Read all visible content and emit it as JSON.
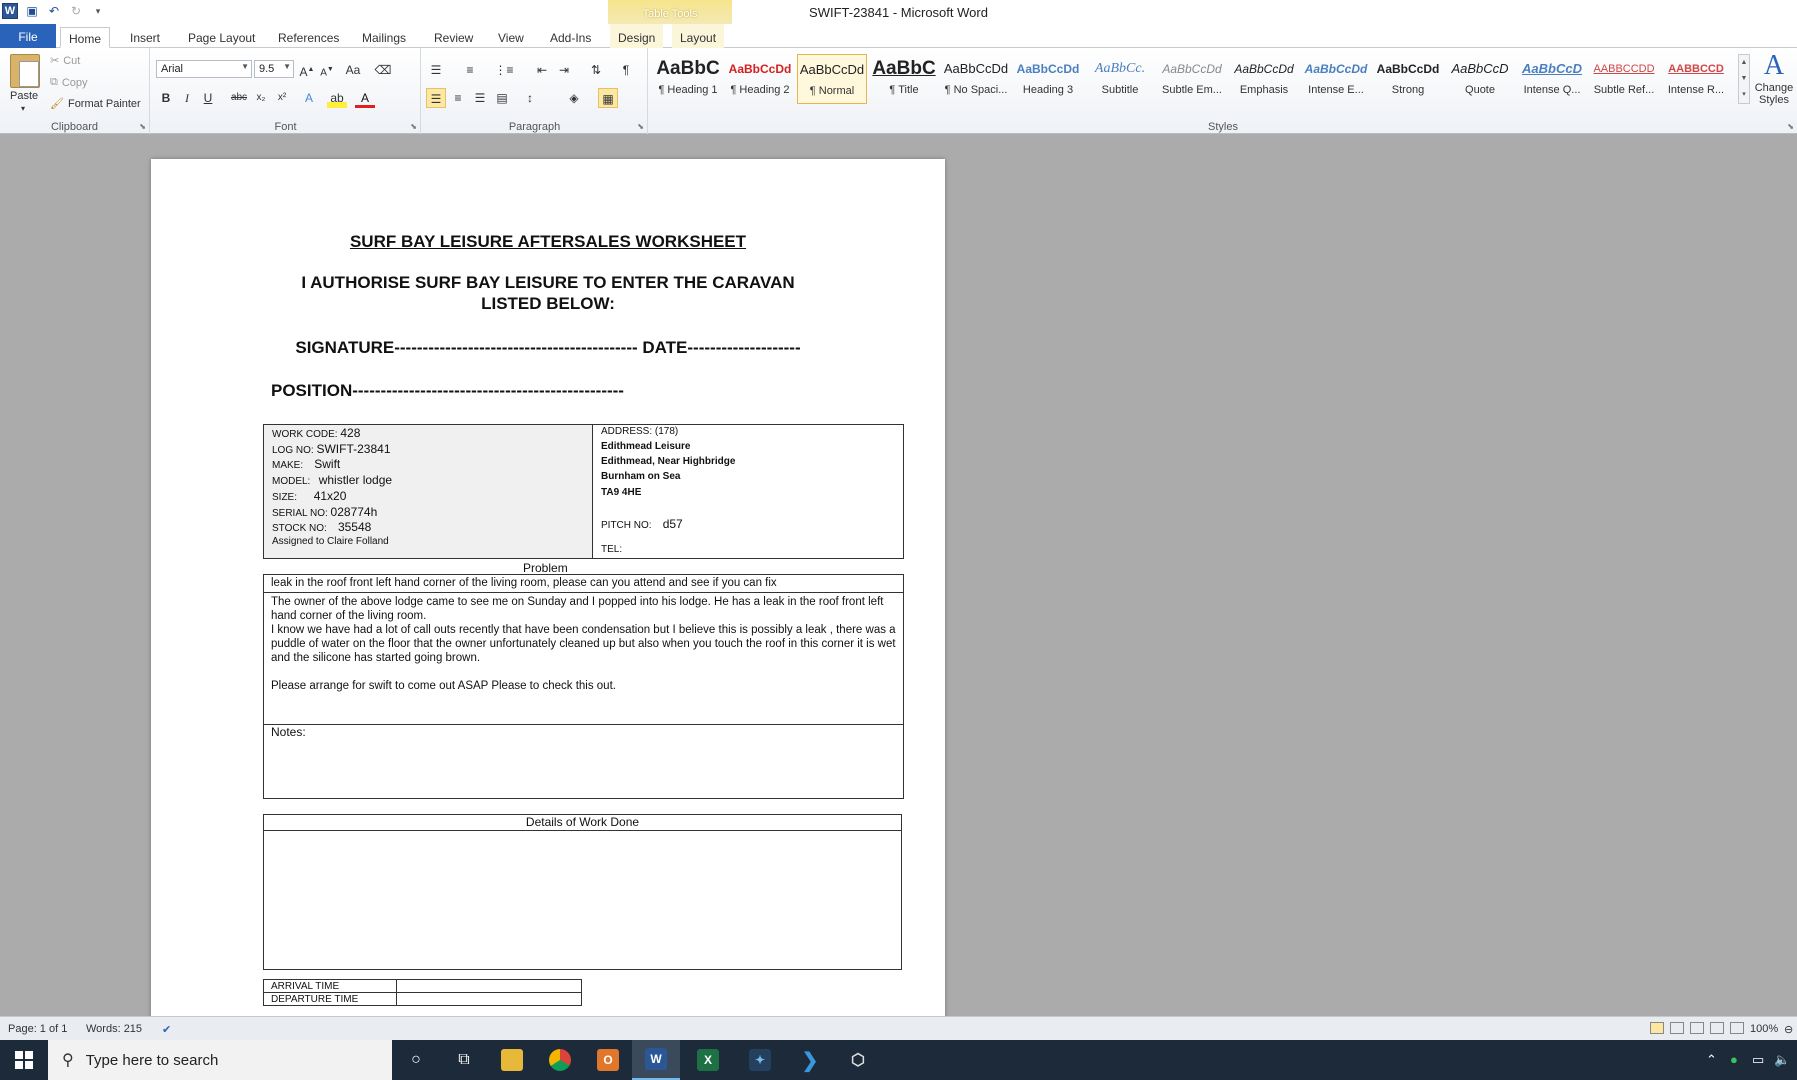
{
  "window": {
    "title": "SWIFT-23841  -  Microsoft Word",
    "table_tools_label": "Table Tools"
  },
  "tabs": [
    {
      "label": "File"
    },
    {
      "label": "Home"
    },
    {
      "label": "Insert"
    },
    {
      "label": "Page Layout"
    },
    {
      "label": "References"
    },
    {
      "label": "Mailings"
    },
    {
      "label": "Review"
    },
    {
      "label": "View"
    },
    {
      "label": "Add-Ins"
    },
    {
      "label": "Design"
    },
    {
      "label": "Layout"
    }
  ],
  "clipboard": {
    "paste": "Paste",
    "cut": "Cut",
    "copy": "Copy",
    "format_painter": "Format Painter",
    "group": "Clipboard"
  },
  "font": {
    "name": "Arial",
    "size": "9.5",
    "group": "Font"
  },
  "paragraph": {
    "group": "Paragraph"
  },
  "styles": {
    "group": "Styles",
    "items": [
      {
        "sample": "AaBbC",
        "name": "¶ Heading 1"
      },
      {
        "sample": "AaBbCcDd",
        "name": "¶ Heading 2"
      },
      {
        "sample": "AaBbCcDd",
        "name": "¶ Normal"
      },
      {
        "sample": "AaBbC",
        "name": "¶ Title"
      },
      {
        "sample": "AaBbCcDd",
        "name": "¶ No Spaci..."
      },
      {
        "sample": "AaBbCcDd",
        "name": "Heading 3"
      },
      {
        "sample": "AaBbCc.",
        "name": "Subtitle"
      },
      {
        "sample": "AaBbCcDd",
        "name": "Subtle Em..."
      },
      {
        "sample": "AaBbCcDd",
        "name": "Emphasis"
      },
      {
        "sample": "AaBbCcDd",
        "name": "Intense E..."
      },
      {
        "sample": "AaBbCcDd",
        "name": "Strong"
      },
      {
        "sample": "AaBbCcD",
        "name": "Quote"
      },
      {
        "sample": "AaBbCcD",
        "name": "Intense Q..."
      },
      {
        "sample": "AABBCCDD",
        "name": "Subtle Ref..."
      },
      {
        "sample": "AABBCCD",
        "name": "Intense R..."
      }
    ],
    "change_styles": "Change Styles"
  },
  "document": {
    "title": "SURF BAY LEISURE AFTERSALES WORKSHEET",
    "authorise_line1": "I AUTHORISE SURF BAY LEISURE TO ENTER THE CARAVAN",
    "authorise_line2": "LISTED BELOW:",
    "signature_line": "SIGNATURE------------------------------------------- DATE--------------------",
    "position_line": "POSITION------------------------------------------------",
    "info": {
      "work_code_label": "WORK CODE:",
      "work_code": "428",
      "log_no_label": "LOG NO:",
      "log_no": "SWIFT-23841",
      "make_label": "MAKE:",
      "make": "Swift",
      "model_label": "MODEL:",
      "model": "whistler lodge",
      "size_label": "SIZE:",
      "size": "41x20",
      "serial_label": "SERIAL  NO:",
      "serial": "028774h",
      "stock_label": "STOCK NO:",
      "stock": "35548",
      "assigned": "Assigned to Claire Folland"
    },
    "address": {
      "label": "ADDRESS:  (178)",
      "line1": "Edithmead Leisure",
      "line2": "Edithmead, Near Highbridge",
      "line3": "Burnham on Sea",
      "line4": "TA9 4HE",
      "pitch_label": "PITCH NO:",
      "pitch": "d57",
      "tel_label": "TEL:"
    },
    "problem_label": "Problem",
    "problem_summary": "leak in the roof  front left hand corner of the living room, please can you attend and see if you can fix",
    "problem_para1": "The owner of the above lodge came to see me on Sunday and I popped into his lodge. He has a leak in the roof  front left hand corner of the living room.",
    "problem_para2": "I know we have had a lot of call outs recently that have been condensation but I believe this is possibly a leak , there was a puddle of water on the floor that the owner unfortunately cleaned up but also when you touch the roof in this corner it is wet and the silicone has started going brown.",
    "problem_para3": "Please arrange for swift to come out ASAP Please to check this out.",
    "notes_label": "Notes:",
    "details_label": "Details of Work Done",
    "arrival_label": "ARRIVAL  TIME",
    "departure_label": "DEPARTURE  TIME"
  },
  "status": {
    "page": "Page: 1 of 1",
    "words": "Words: 215",
    "zoom": "100%"
  },
  "taskbar": {
    "search_placeholder": "Type here to search"
  }
}
